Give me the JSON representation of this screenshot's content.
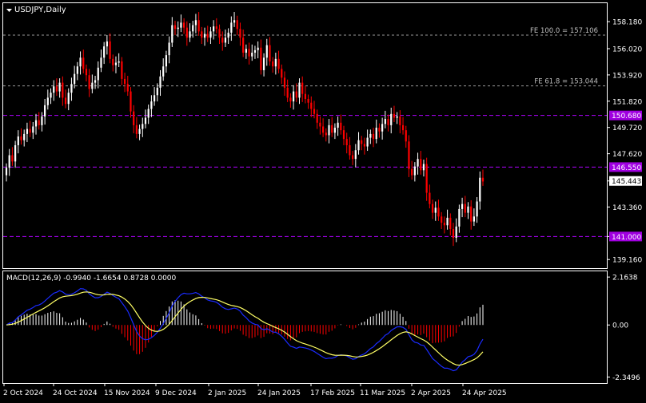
{
  "symbol_label": "USDJPY,Daily",
  "colors": {
    "background": "#000000",
    "frame": "#ffffff",
    "bull_candle": "#ffffff",
    "bear_candle": "#ff0000",
    "fib_line": "#9a9a9a",
    "level_line": "#b000ff",
    "macd_line": "#1a2bff",
    "signal_line": "#ffff66",
    "hist_pos": "#ffffff",
    "hist_neg": "#ff0000"
  },
  "chart_data": [
    {
      "type": "candlestick",
      "title": "USDJPY,Daily",
      "ylim": [
        138.6,
        159.4
      ],
      "y_ticks": [
        "158.180",
        "156.020",
        "153.920",
        "151.820",
        "149.720",
        "147.620",
        "145.443",
        "143.360",
        "141.000",
        "139.160"
      ],
      "x_ticks": [
        "2 Oct 2024",
        "24 Oct 2024",
        "15 Nov 2024",
        "9 Dec 2024",
        "2 Jan 2025",
        "24 Jan 2025",
        "17 Feb 2025",
        "11 Mar 2025",
        "2 Apr 2025",
        "24 Apr 2025"
      ],
      "fib_levels": [
        {
          "label": "FE 100.0 = 157.106",
          "value": 157.106
        },
        {
          "label": "FE 61.8 = 153.044",
          "value": 153.044
        }
      ],
      "price_levels": [
        {
          "label": "150.680",
          "value": 150.68
        },
        {
          "label": "146.550",
          "value": 146.55
        },
        {
          "label": "141.000",
          "value": 141.0
        }
      ],
      "current_price": {
        "label": "145.443",
        "value": 145.443
      },
      "close": [
        146.5,
        147.5,
        147.0,
        148.3,
        149.0,
        148.7,
        149.2,
        149.6,
        149.3,
        149.8,
        150.3,
        149.9,
        150.6,
        151.5,
        152.1,
        152.5,
        153.0,
        152.6,
        153.3,
        152.1,
        151.6,
        152.5,
        153.2,
        154.0,
        154.6,
        155.3,
        154.4,
        153.9,
        152.8,
        153.3,
        153.5,
        154.5,
        155.3,
        156.2,
        156.6,
        155.2,
        154.7,
        154.9,
        155.0,
        153.6,
        153.2,
        152.6,
        151.0,
        149.9,
        149.2,
        149.6,
        150.0,
        150.5,
        151.2,
        151.8,
        152.3,
        152.9,
        153.8,
        154.6,
        155.5,
        156.5,
        157.9,
        157.6,
        157.7,
        158.1,
        157.7,
        156.9,
        157.4,
        157.9,
        158.3,
        157.4,
        156.9,
        157.2,
        156.9,
        157.4,
        157.8,
        157.6,
        156.9,
        156.5,
        156.9,
        157.3,
        158.1,
        158.3,
        157.6,
        156.9,
        155.7,
        156.0,
        155.4,
        155.7,
        155.9,
        156.1,
        154.3,
        155.3,
        156.3,
        155.0,
        154.6,
        155.2,
        154.4,
        153.7,
        152.9,
        152.1,
        151.8,
        152.6,
        152.1,
        153.3,
        152.4,
        152.0,
        151.7,
        151.2,
        150.8,
        150.1,
        149.8,
        149.3,
        149.1,
        149.9,
        149.3,
        149.7,
        150.1,
        149.5,
        148.8,
        148.3,
        147.5,
        147.2,
        147.9,
        148.7,
        148.4,
        148.2,
        148.9,
        149.2,
        148.8,
        149.7,
        149.4,
        150.0,
        150.4,
        149.9,
        150.8,
        150.5,
        150.6,
        149.9,
        149.5,
        148.6,
        146.4,
        145.9,
        146.6,
        147.2,
        146.3,
        146.8,
        144.5,
        143.6,
        142.9,
        143.3,
        142.6,
        142.1,
        141.9,
        142.5,
        141.6,
        140.9,
        141.8,
        143.2,
        143.6,
        142.9,
        143.4,
        142.2,
        142.6,
        143.8,
        145.7,
        145.4
      ],
      "macd": {
        "label": "MACD(12,26,9) -0.9940 -1.6654 0.8728 0.0000",
        "y_ticks": [
          "2.1638",
          "0.00",
          "-2.3496"
        ],
        "ylim": [
          -2.55,
          2.35
        ]
      }
    }
  ]
}
